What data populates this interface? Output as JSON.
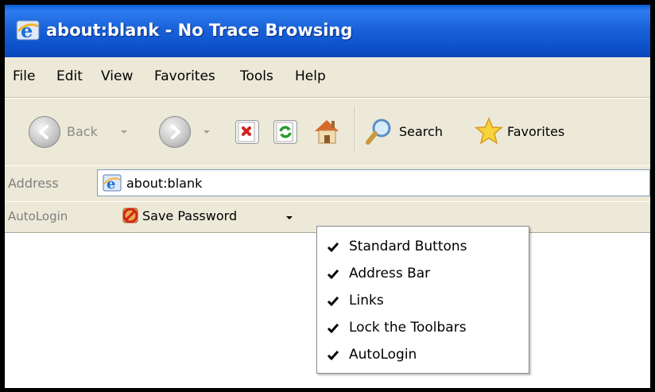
{
  "window": {
    "title": "about:blank - No Trace Browsing"
  },
  "menubar": {
    "items": [
      "File",
      "Edit",
      "View",
      "Favorites",
      "Tools",
      "Help"
    ]
  },
  "toolbar": {
    "back_label": "Back",
    "search_label": "Search",
    "favorites_label": "Favorites"
  },
  "addressbar": {
    "label": "Address",
    "value": "about:blank"
  },
  "autologin": {
    "label": "AutoLogin",
    "save_password_label": "Save Password"
  },
  "context_menu": {
    "items": [
      {
        "label": "Standard Buttons",
        "checked": true
      },
      {
        "label": "Address Bar",
        "checked": true
      },
      {
        "label": "Links",
        "checked": true
      },
      {
        "label": "Lock the Toolbars",
        "checked": true
      },
      {
        "label": "AutoLogin",
        "checked": true
      }
    ]
  },
  "colors": {
    "titlebar": "#0b4fc8",
    "chrome": "#ece9d8",
    "title_text": "#ffffff"
  }
}
